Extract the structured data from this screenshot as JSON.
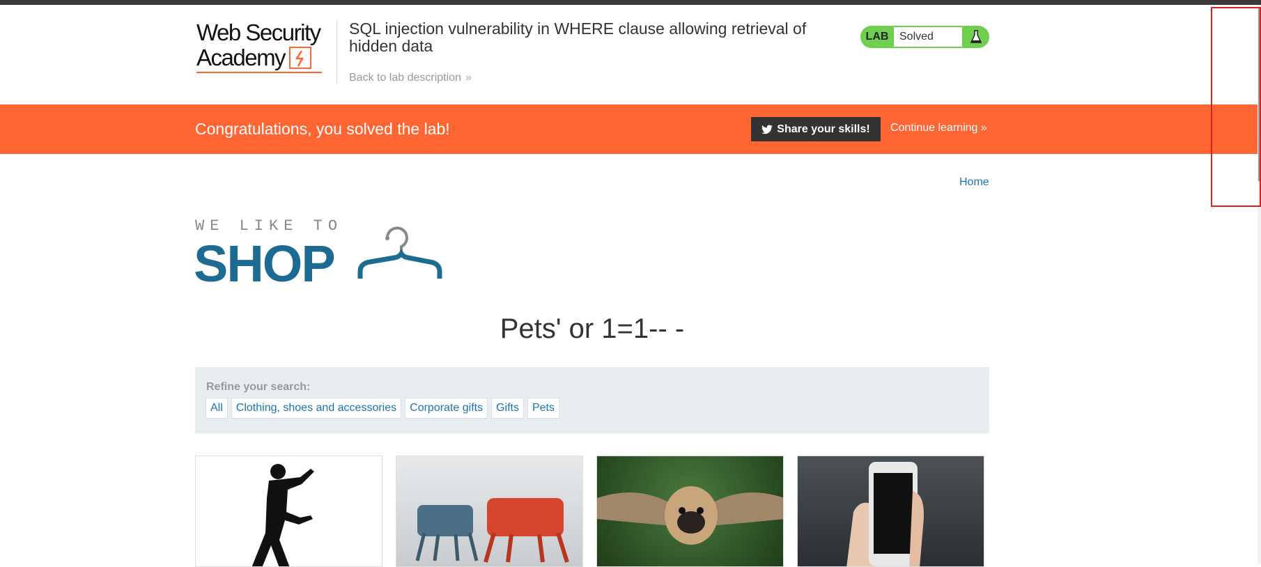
{
  "header": {
    "logo_line1": "Web Security",
    "logo_line2": "Academy",
    "lab_title": "SQL injection vulnerability in WHERE clause allowing retrieval of hidden data",
    "back_link": "Back to lab description",
    "badge_label": "LAB",
    "badge_status": "Solved"
  },
  "banner": {
    "message": "Congratulations, you solved the lab!",
    "share_label": "Share your skills!",
    "continue_label": "Continue learning"
  },
  "nav": {
    "home": "Home"
  },
  "shop_logo": {
    "tagline": "WE LIKE TO",
    "word": "SHOP"
  },
  "main": {
    "query_title": "Pets' or 1=1-- -",
    "refine_label": "Refine your search:",
    "filters": [
      "All",
      "Clothing, shoes and accessories",
      "Corporate gifts",
      "Gifts",
      "Pets"
    ]
  },
  "colors": {
    "brand_orange": "#ff6633",
    "shop_blue": "#1d6b92",
    "link_blue": "#1a73b8",
    "solved_green": "#6fcf4f"
  }
}
